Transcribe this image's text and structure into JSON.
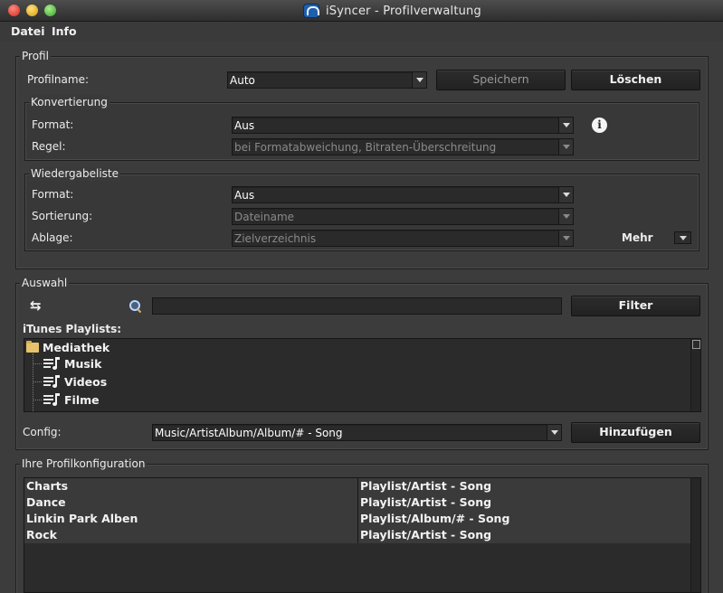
{
  "window": {
    "title": "iSyncer - Profilverwaltung",
    "app_icon": "headphones-icon"
  },
  "menu": {
    "items": [
      "Datei",
      "Info"
    ]
  },
  "profil": {
    "group_title": "Profil",
    "name_label": "Profilname:",
    "name_value": "Auto",
    "save_label": "Speichern",
    "delete_label": "Löschen",
    "konvertierung": {
      "group_title": "Konvertierung",
      "format_label": "Format:",
      "format_value": "Aus",
      "regel_label": "Regel:",
      "regel_value": "bei Formatabweichung, Bitraten-Überschreitung",
      "info_icon_glyph": "i"
    },
    "wiedergabeliste": {
      "group_title": "Wiedergabeliste",
      "format_label": "Format:",
      "format_value": "Aus",
      "sortierung_label": "Sortierung:",
      "sortierung_value": "Dateiname",
      "ablage_label": "Ablage:",
      "ablage_value": "Zielverzeichnis",
      "mehr_label": "Mehr"
    }
  },
  "auswahl": {
    "group_title": "Auswahl",
    "search_value": "",
    "filter_label": "Filter",
    "playlists_label": "iTunes Playlists:",
    "tree": {
      "root": "Mediathek",
      "children": [
        "Musik",
        "Videos",
        "Filme"
      ]
    },
    "config_label": "Config:",
    "config_value": "Music/ArtistAlbum/Album/# - Song",
    "add_label": "Hinzufügen"
  },
  "profilkonfiguration": {
    "group_title": "Ihre Profilkonfiguration",
    "rows": [
      {
        "playlist": "Charts",
        "config": "Playlist/Artist - Song"
      },
      {
        "playlist": "Dance",
        "config": "Playlist/Artist - Song"
      },
      {
        "playlist": "Linkin Park Alben",
        "config": "Playlist/Album/# - Song"
      },
      {
        "playlist": "Rock",
        "config": "Playlist/Artist - Song"
      }
    ]
  },
  "colors": {
    "background": "#3c3c3c",
    "field": "#2a2a2a",
    "text": "#ececec",
    "disabled_text": "#8a8a8a"
  }
}
